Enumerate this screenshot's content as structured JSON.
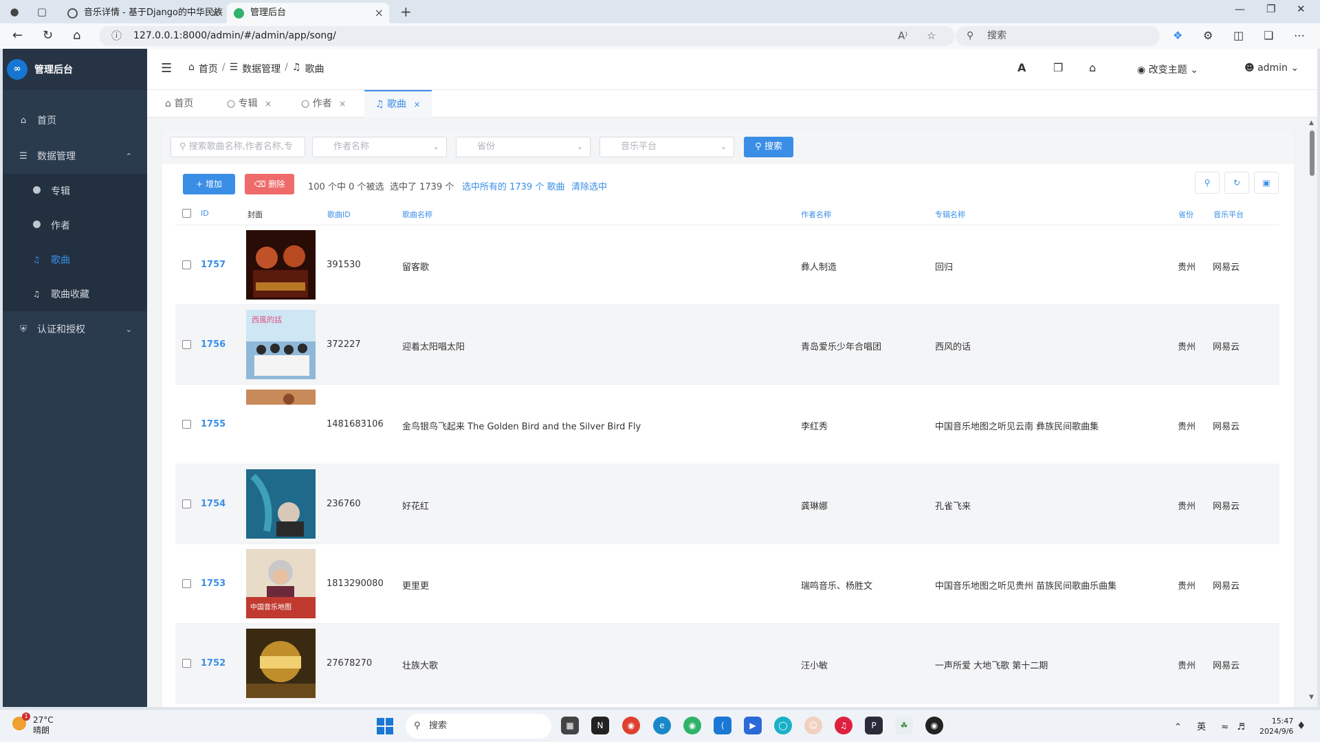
{
  "browser": {
    "tabs": [
      {
        "title": "音乐详情 - 基于Django的中华民族"
      },
      {
        "title": "管理后台"
      }
    ],
    "url": "127.0.0.1:8000/admin/#/admin/app/song/",
    "search_placeholder": "搜索"
  },
  "sidebar": {
    "app_title": "管理后台",
    "items": [
      {
        "label": "首页"
      },
      {
        "label": "数据管理"
      },
      {
        "label": "认证和授权"
      }
    ],
    "sub_items": [
      {
        "label": "专辑"
      },
      {
        "label": "作者"
      },
      {
        "label": "歌曲"
      },
      {
        "label": "歌曲收藏"
      }
    ]
  },
  "header": {
    "breadcrumb": [
      "首页",
      "数据管理",
      "歌曲"
    ],
    "theme_label": "改变主题",
    "user_label": "admin"
  },
  "page_tabs": [
    {
      "label": "首页"
    },
    {
      "label": "专辑"
    },
    {
      "label": "作者"
    },
    {
      "label": "歌曲"
    }
  ],
  "filters": {
    "search_placeholder": "搜索歌曲名称,作者名称,专",
    "author_placeholder": "作者名称",
    "province_placeholder": "省份",
    "platform_placeholder": "音乐平台",
    "search_button": "搜索"
  },
  "actions": {
    "add_label": "增加",
    "delete_label": "删除",
    "selection_info": "100 个中 0 个被选",
    "selected_info": "选中了 1739 个",
    "select_all_link": "选中所有的 1739 个 歌曲",
    "clear_link": "清除选中"
  },
  "table": {
    "headers": [
      "ID",
      "封面",
      "歌曲ID",
      "歌曲名称",
      "作者名称",
      "专辑名称",
      "省份",
      "音乐平台"
    ],
    "rows": [
      {
        "id": "1757",
        "song_id": "391530",
        "name": "留客歌",
        "author": "彝人制造",
        "album": "回归",
        "province": "贵州",
        "platform": "网易云"
      },
      {
        "id": "1756",
        "song_id": "372227",
        "name": "迎着太阳唱太阳",
        "author": "青岛爱乐少年合唱团",
        "album": "西风的话",
        "province": "贵州",
        "platform": "网易云"
      },
      {
        "id": "1755",
        "song_id": "1481683106",
        "name": "金鸟银鸟飞起来 The Golden Bird and the Silver Bird Fly",
        "author": "李红秀",
        "album": "中国音乐地图之听见云南 彝族民间歌曲集",
        "province": "贵州",
        "platform": "网易云"
      },
      {
        "id": "1754",
        "song_id": "236760",
        "name": "好花红",
        "author": "龚琳娜",
        "album": "孔雀飞来",
        "province": "贵州",
        "platform": "网易云"
      },
      {
        "id": "1753",
        "song_id": "1813290080",
        "name": "更里更",
        "author": "瑞鸣音乐、杨胜文",
        "album": "中国音乐地图之听见贵州 苗族民间歌曲乐曲集",
        "province": "贵州",
        "platform": "网易云"
      },
      {
        "id": "1752",
        "song_id": "27678270",
        "name": "壮族大歌",
        "author": "汪小敏",
        "album": "一声所爱 大地飞歌 第十二期",
        "province": "贵州",
        "platform": "网易云"
      }
    ],
    "cover_texts": [
      "西風的話",
      "中国音乐地图"
    ]
  },
  "taskbar": {
    "temperature": "27°C",
    "weather": "晴朗",
    "search_label": "搜索",
    "ime": "英",
    "time": "15:47",
    "date": "2024/9/6",
    "weather_badge": "1"
  },
  "colors": {
    "sidebar_bg": "#2b3b4e",
    "accent": "#3a8ee6",
    "danger": "#ef6b6b"
  }
}
